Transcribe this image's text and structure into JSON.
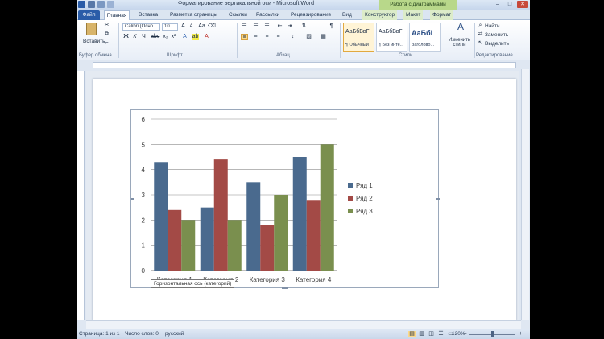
{
  "window": {
    "title": "Форматирование вертикальной оси - Microsoft Word",
    "tools_group": "Работа с диаграммами"
  },
  "tabs": [
    {
      "label": "Файл"
    },
    {
      "label": "Главная"
    },
    {
      "label": "Вставка"
    },
    {
      "label": "Разметка страницы"
    },
    {
      "label": "Ссылки"
    },
    {
      "label": "Рассылки"
    },
    {
      "label": "Рецензирование"
    },
    {
      "label": "Вид"
    },
    {
      "label": "Конструктор"
    },
    {
      "label": "Макет"
    },
    {
      "label": "Формат"
    }
  ],
  "ribbon": {
    "paste_label": "Вставить",
    "clipboard_label": "Буфер обмена",
    "font_name": "Calibri (Осно",
    "font_size": "10",
    "font_group_label": "Шрифт",
    "paragraph_group_label": "Абзац",
    "styles": [
      {
        "sample": "АаБбВвГ",
        "name": "¶ Обычный"
      },
      {
        "sample": "АаБбВвГ",
        "name": "¶ Без инте..."
      },
      {
        "sample": "АаБбI",
        "name": "Заголово..."
      }
    ],
    "styles_group_label": "Стили",
    "change_styles_label": "Изменить стили",
    "find_label": "Найти",
    "replace_label": "Заменить",
    "select_label": "Выделить",
    "editing_group_label": "Редактирование"
  },
  "chart_data": {
    "type": "bar",
    "categories": [
      "Категория 1",
      "Категория 2",
      "Категория 3",
      "Категория 4"
    ],
    "series": [
      {
        "name": "Ряд 1",
        "values": [
          4.3,
          2.5,
          3.5,
          4.5
        ],
        "color": "#4a6a8e"
      },
      {
        "name": "Ряд 2",
        "values": [
          2.4,
          4.4,
          1.8,
          2.8
        ],
        "color": "#a34a46"
      },
      {
        "name": "Ряд 3",
        "values": [
          2.0,
          2.0,
          3.0,
          5.0
        ],
        "color": "#7a8f4e"
      }
    ],
    "yticks": [
      "0",
      "1",
      "2",
      "3",
      "4",
      "5",
      "6"
    ],
    "ylim": [
      0,
      6
    ],
    "grid": true,
    "legend_position": "right"
  },
  "tooltip": "Горизонтальная ось (категорий)",
  "status": {
    "page": "Страница: 1 из 1",
    "words": "Число слов: 0",
    "language": "русский",
    "zoom": "120%",
    "zoom_value": 120
  },
  "colors": {
    "file_tab": "#2a5ca8",
    "chart_tools_accent": "#b8d88a"
  }
}
